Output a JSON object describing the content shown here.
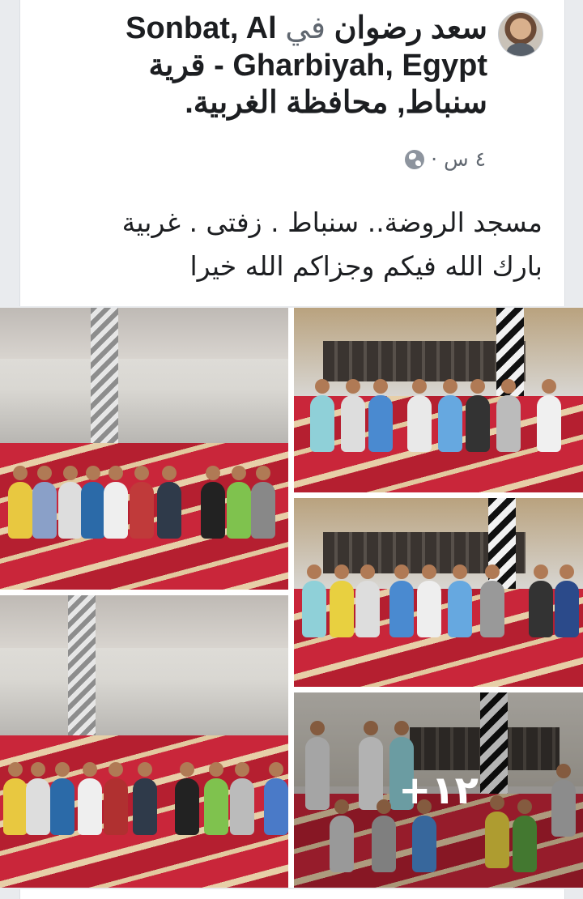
{
  "post": {
    "author_name": "سعد رضوان",
    "in_word": "في",
    "location": "Sonbat, Al Gharbiyah, Egypt - قرية سنباط, محافظة الغربية.",
    "location_line1": "Sonbat, Al",
    "location_line2": "Gharbiyah, Egypt - قرية",
    "location_line3": "سنباط, محافظة الغربية.",
    "time": "٤ س",
    "separator": "·",
    "privacy_icon": "globe-icon",
    "text_line1": "مسجد الروضة.. سنباط . زفتى . غربية",
    "text_line2": "بارك الله فيكم وجزاكم الله خيرا"
  },
  "gallery": {
    "photos": [
      {
        "alt": "photo-1"
      },
      {
        "alt": "photo-2"
      },
      {
        "alt": "photo-3"
      },
      {
        "alt": "photo-4"
      },
      {
        "alt": "photo-5"
      }
    ],
    "more_count": "+١٢"
  },
  "colors": {
    "text_primary": "#1c1e21",
    "text_secondary": "#606770",
    "carpet_red": "#c9263a"
  }
}
